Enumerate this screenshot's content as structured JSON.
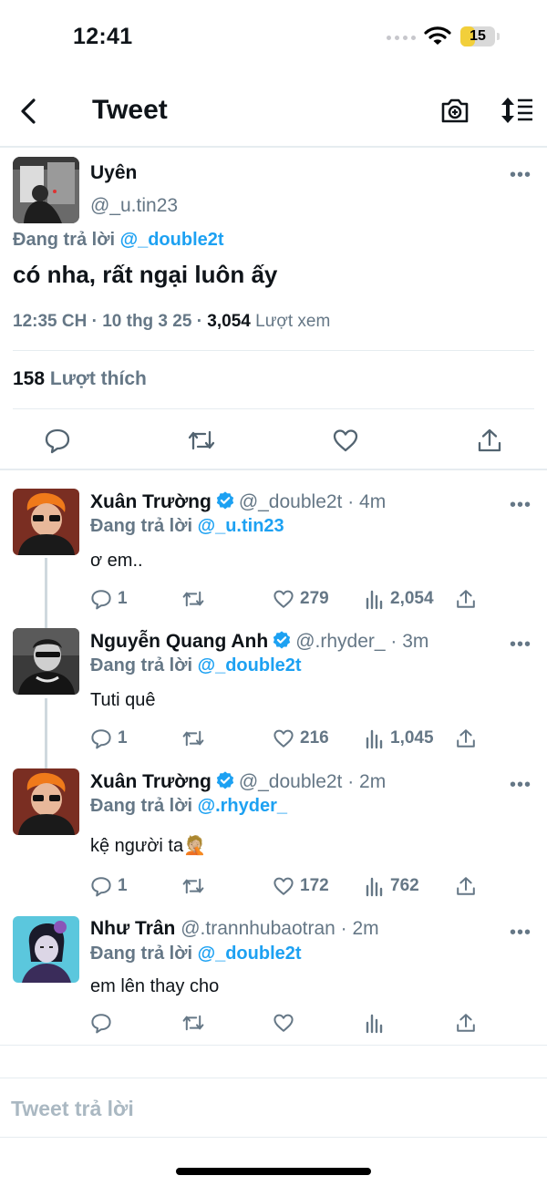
{
  "status_bar": {
    "time": "12:41",
    "battery": "15",
    "battery_level": 0.15,
    "icons": [
      "cellular-dots-icon",
      "wifi-icon",
      "battery-icon"
    ]
  },
  "nav": {
    "title": "Tweet",
    "icons": [
      "back-chevron-icon",
      "camera-icon",
      "sort-icon"
    ]
  },
  "main_tweet": {
    "name": "Uyên",
    "handle": "@_u.tin23",
    "reply_prefix": "Đang trả lời ",
    "reply_to": "@_double2t",
    "text": "có nha, rất ngại luôn ấy",
    "timestamp": "12:35 CH · 10 thg 3 25 · ",
    "views": "3,054",
    "views_label": " Lượt xem",
    "likes": "158",
    "likes_label": " Lượt thích"
  },
  "replies": [
    {
      "name": "Xuân Trường",
      "verified": true,
      "handle": "@_double2t",
      "time": " · 4m",
      "reply_prefix": "Đang trả lời ",
      "reply_to": "@_u.tin23",
      "text": "ơ em..",
      "replies": "1",
      "retweets": "",
      "likes": "279",
      "views": "2,054"
    },
    {
      "name": "Nguyễn Quang Anh",
      "verified": true,
      "handle": "@.rhyder_",
      "time": " · 3m",
      "reply_prefix": "Đang trả lời ",
      "reply_to": "@_double2t",
      "text": "Tuti quê",
      "replies": "1",
      "retweets": "",
      "likes": "216",
      "views": "1,045"
    },
    {
      "name": "Xuân Trường",
      "verified": true,
      "handle": "@_double2t",
      "time": " · 2m",
      "reply_prefix": "Đang trả lời ",
      "reply_to": "@.rhyder_",
      "text": "kệ người ta🤦🏼",
      "replies": "1",
      "retweets": "",
      "likes": "172",
      "views": "762"
    },
    {
      "name": "Như Trân",
      "verified": false,
      "handle": "@.trannhubaotran",
      "time": " · 2m",
      "reply_prefix": "Đang trả lời ",
      "reply_to": "@_double2t",
      "text": "em lên thay cho",
      "replies": "",
      "retweets": "",
      "likes": "",
      "views": ""
    }
  ],
  "reply_box": {
    "placeholder": "Tweet trả lời"
  },
  "colors": {
    "accent": "#1da1f2",
    "muted": "#657786",
    "text": "#0f1419",
    "divider": "#e6ecf0",
    "battery": "#f2cf3a"
  }
}
